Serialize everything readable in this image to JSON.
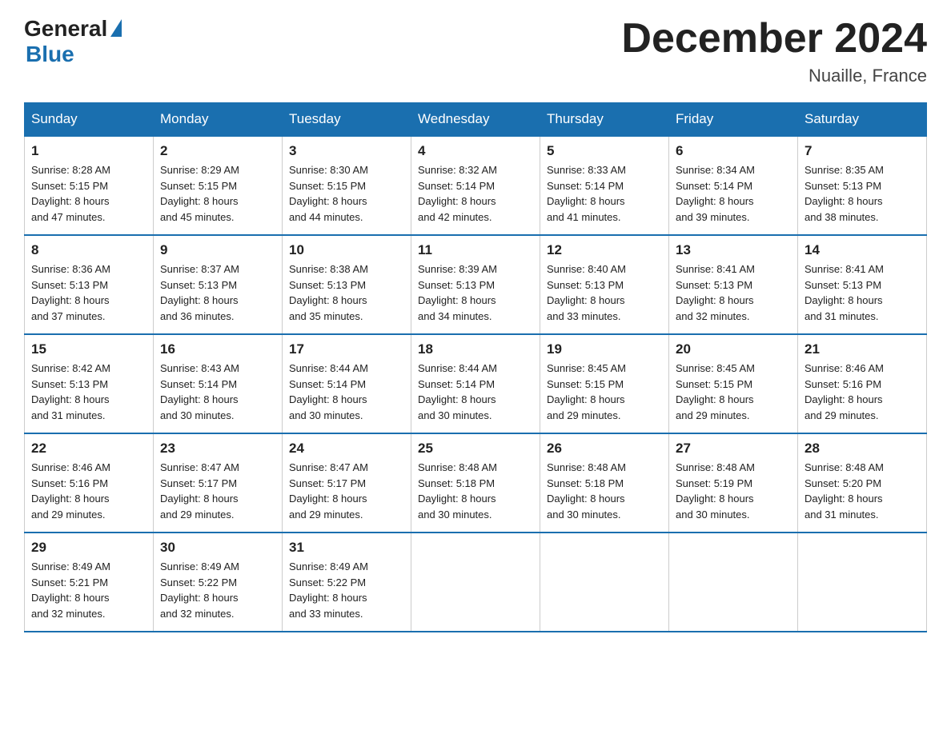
{
  "header": {
    "logo_general": "General",
    "logo_blue": "Blue",
    "month_title": "December 2024",
    "location": "Nuaille, France"
  },
  "days_of_week": [
    "Sunday",
    "Monday",
    "Tuesday",
    "Wednesday",
    "Thursday",
    "Friday",
    "Saturday"
  ],
  "weeks": [
    [
      {
        "day": "1",
        "sunrise": "8:28 AM",
        "sunset": "5:15 PM",
        "daylight": "8 hours and 47 minutes."
      },
      {
        "day": "2",
        "sunrise": "8:29 AM",
        "sunset": "5:15 PM",
        "daylight": "8 hours and 45 minutes."
      },
      {
        "day": "3",
        "sunrise": "8:30 AM",
        "sunset": "5:15 PM",
        "daylight": "8 hours and 44 minutes."
      },
      {
        "day": "4",
        "sunrise": "8:32 AM",
        "sunset": "5:14 PM",
        "daylight": "8 hours and 42 minutes."
      },
      {
        "day": "5",
        "sunrise": "8:33 AM",
        "sunset": "5:14 PM",
        "daylight": "8 hours and 41 minutes."
      },
      {
        "day": "6",
        "sunrise": "8:34 AM",
        "sunset": "5:14 PM",
        "daylight": "8 hours and 39 minutes."
      },
      {
        "day": "7",
        "sunrise": "8:35 AM",
        "sunset": "5:13 PM",
        "daylight": "8 hours and 38 minutes."
      }
    ],
    [
      {
        "day": "8",
        "sunrise": "8:36 AM",
        "sunset": "5:13 PM",
        "daylight": "8 hours and 37 minutes."
      },
      {
        "day": "9",
        "sunrise": "8:37 AM",
        "sunset": "5:13 PM",
        "daylight": "8 hours and 36 minutes."
      },
      {
        "day": "10",
        "sunrise": "8:38 AM",
        "sunset": "5:13 PM",
        "daylight": "8 hours and 35 minutes."
      },
      {
        "day": "11",
        "sunrise": "8:39 AM",
        "sunset": "5:13 PM",
        "daylight": "8 hours and 34 minutes."
      },
      {
        "day": "12",
        "sunrise": "8:40 AM",
        "sunset": "5:13 PM",
        "daylight": "8 hours and 33 minutes."
      },
      {
        "day": "13",
        "sunrise": "8:41 AM",
        "sunset": "5:13 PM",
        "daylight": "8 hours and 32 minutes."
      },
      {
        "day": "14",
        "sunrise": "8:41 AM",
        "sunset": "5:13 PM",
        "daylight": "8 hours and 31 minutes."
      }
    ],
    [
      {
        "day": "15",
        "sunrise": "8:42 AM",
        "sunset": "5:13 PM",
        "daylight": "8 hours and 31 minutes."
      },
      {
        "day": "16",
        "sunrise": "8:43 AM",
        "sunset": "5:14 PM",
        "daylight": "8 hours and 30 minutes."
      },
      {
        "day": "17",
        "sunrise": "8:44 AM",
        "sunset": "5:14 PM",
        "daylight": "8 hours and 30 minutes."
      },
      {
        "day": "18",
        "sunrise": "8:44 AM",
        "sunset": "5:14 PM",
        "daylight": "8 hours and 30 minutes."
      },
      {
        "day": "19",
        "sunrise": "8:45 AM",
        "sunset": "5:15 PM",
        "daylight": "8 hours and 29 minutes."
      },
      {
        "day": "20",
        "sunrise": "8:45 AM",
        "sunset": "5:15 PM",
        "daylight": "8 hours and 29 minutes."
      },
      {
        "day": "21",
        "sunrise": "8:46 AM",
        "sunset": "5:16 PM",
        "daylight": "8 hours and 29 minutes."
      }
    ],
    [
      {
        "day": "22",
        "sunrise": "8:46 AM",
        "sunset": "5:16 PM",
        "daylight": "8 hours and 29 minutes."
      },
      {
        "day": "23",
        "sunrise": "8:47 AM",
        "sunset": "5:17 PM",
        "daylight": "8 hours and 29 minutes."
      },
      {
        "day": "24",
        "sunrise": "8:47 AM",
        "sunset": "5:17 PM",
        "daylight": "8 hours and 29 minutes."
      },
      {
        "day": "25",
        "sunrise": "8:48 AM",
        "sunset": "5:18 PM",
        "daylight": "8 hours and 30 minutes."
      },
      {
        "day": "26",
        "sunrise": "8:48 AM",
        "sunset": "5:18 PM",
        "daylight": "8 hours and 30 minutes."
      },
      {
        "day": "27",
        "sunrise": "8:48 AM",
        "sunset": "5:19 PM",
        "daylight": "8 hours and 30 minutes."
      },
      {
        "day": "28",
        "sunrise": "8:48 AM",
        "sunset": "5:20 PM",
        "daylight": "8 hours and 31 minutes."
      }
    ],
    [
      {
        "day": "29",
        "sunrise": "8:49 AM",
        "sunset": "5:21 PM",
        "daylight": "8 hours and 32 minutes."
      },
      {
        "day": "30",
        "sunrise": "8:49 AM",
        "sunset": "5:22 PM",
        "daylight": "8 hours and 32 minutes."
      },
      {
        "day": "31",
        "sunrise": "8:49 AM",
        "sunset": "5:22 PM",
        "daylight": "8 hours and 33 minutes."
      },
      null,
      null,
      null,
      null
    ]
  ],
  "labels": {
    "sunrise": "Sunrise:",
    "sunset": "Sunset:",
    "daylight": "Daylight:"
  }
}
